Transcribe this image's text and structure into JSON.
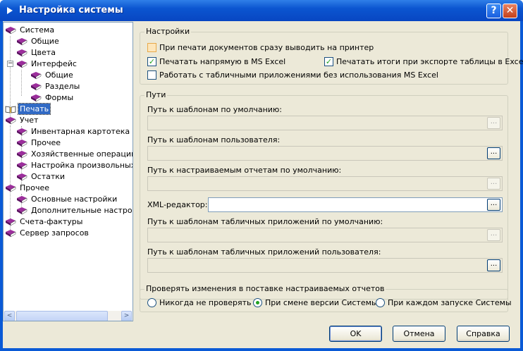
{
  "window": {
    "title": "Настройка системы",
    "help_glyph": "?",
    "close_glyph": "✕"
  },
  "tree": {
    "items": [
      {
        "label": "Система"
      },
      {
        "label": "Общие"
      },
      {
        "label": "Цвета"
      },
      {
        "label": "Интерфейс"
      },
      {
        "label": "Общие"
      },
      {
        "label": "Разделы"
      },
      {
        "label": "Формы"
      },
      {
        "label": "Печать"
      },
      {
        "label": "Учет"
      },
      {
        "label": "Инвентарная картотека"
      },
      {
        "label": "Прочее"
      },
      {
        "label": "Хозяйственные операции"
      },
      {
        "label": "Настройка произвольных д"
      },
      {
        "label": "Остатки"
      },
      {
        "label": "Прочее"
      },
      {
        "label": "Основные настройки"
      },
      {
        "label": "Дополнительные настройк"
      },
      {
        "label": "Счета-фактуры"
      },
      {
        "label": "Сервер запросов"
      }
    ],
    "selected": "Печать"
  },
  "settings": {
    "title": "Настройки",
    "checks": [
      {
        "label": "При печати документов сразу выводить на принтер",
        "checked": false
      },
      {
        "label": "Печатать напрямую в MS Excel",
        "checked": true
      },
      {
        "label": "Печатать итоги при экспорте  таблицы в Excel",
        "checked": true
      },
      {
        "label": "Работать с табличными приложениями без использования MS Excel",
        "checked": false
      }
    ]
  },
  "paths": {
    "title": "Пути",
    "fields": [
      {
        "label": "Путь к шаблонам по умолчанию:",
        "value": ""
      },
      {
        "label": "Путь к шаблонам пользователя:",
        "value": ""
      },
      {
        "label": "Путь к настраиваемым отчетам по умолчанию:",
        "value": ""
      },
      {
        "label": "XML-редактор:",
        "value": ""
      },
      {
        "label": "Путь к шаблонам табличных приложений по умолчанию:",
        "value": ""
      },
      {
        "label": "Путь к шаблонам табличных приложений пользователя:",
        "value": ""
      }
    ],
    "browse_label": "..."
  },
  "check_changes": {
    "title": "Проверять изменения в поставке настраиваемых отчетов",
    "options": [
      "Никогда не проверять",
      "При смене версии Системы",
      "При каждом запуске Системы"
    ],
    "selected": "При смене версии Системы"
  },
  "buttons": {
    "ok": "OK",
    "cancel": "Отмена",
    "help": "Справка"
  },
  "scroll": {
    "left": "<",
    "right": ">"
  }
}
